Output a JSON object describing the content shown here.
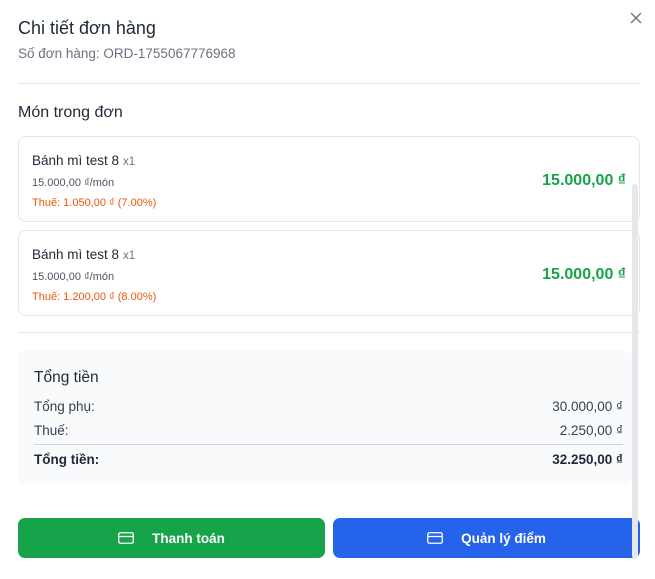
{
  "dialog": {
    "title": "Chi tiết đơn hàng",
    "order_number": "Số đơn hàng: ORD-1755067776968"
  },
  "items_section": {
    "label": "Món trong đơn",
    "items": [
      {
        "name": "Bánh mì test 8",
        "qty": "x1",
        "unit_price": "15.000,00 ₫/món",
        "tax": "Thuế: 1.050,00 ₫ (7.00%)",
        "total": "15.000,00 ₫"
      },
      {
        "name": "Bánh mì test 8",
        "qty": "x1",
        "unit_price": "15.000,00 ₫/món",
        "tax": "Thuế: 1.200,00 ₫ (8.00%)",
        "total": "15.000,00 ₫"
      }
    ]
  },
  "summary": {
    "title": "Tổng tiền",
    "subtotal_label": "Tổng phụ:",
    "subtotal_value": "30.000,00 ₫",
    "tax_label": "Thuế:",
    "tax_value": "2.250,00 ₫",
    "total_label": "Tổng tiền:",
    "total_value": "32.250,00 ₫"
  },
  "actions": {
    "pay_label": "Thanh toán",
    "points_label": "Quản lý điểm"
  },
  "colors": {
    "accent_green": "#16a34a",
    "accent_blue": "#2563eb",
    "tax_orange": "#ea580c"
  },
  "icons": {
    "close": "close-icon",
    "pay": "credit-card-icon",
    "points": "credit-card-icon"
  }
}
